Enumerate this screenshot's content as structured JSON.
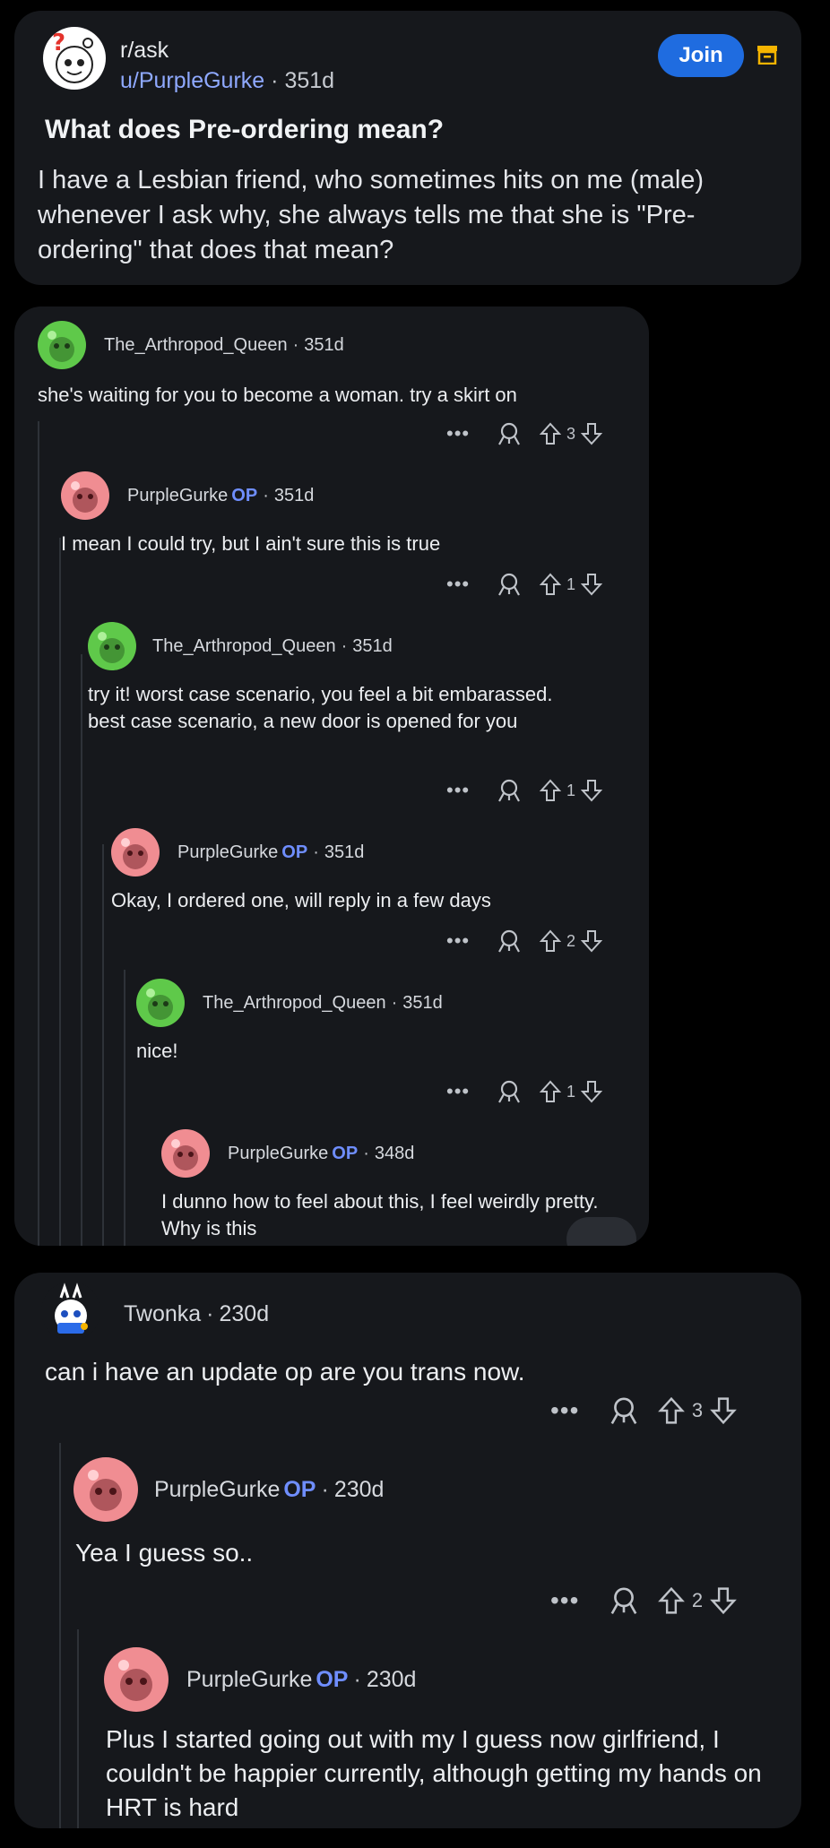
{
  "post": {
    "subreddit": "r/ask",
    "author": "u/PurpleGurke",
    "separator": "·",
    "age": "351d",
    "join_label": "Join",
    "title": "What does Pre-ordering mean?",
    "body": "I have a Lesbian friend, who sometimes hits on me (male) whenever I ask why, she always tells me that she is \"Pre-ordering\" that does that mean?"
  },
  "thread1": {
    "comments": [
      {
        "author": "The_Arthropod_Queen",
        "op": "",
        "age": "351d",
        "text": "she's waiting for you to become a woman.  try a skirt on",
        "votes": "3"
      },
      {
        "author": "PurpleGurke",
        "op": "OP",
        "age": "351d",
        "text": "I mean I could try, but I ain't sure this is true",
        "votes": "1"
      },
      {
        "author": "The_Arthropod_Queen",
        "op": "",
        "age": "351d",
        "text": "try it! worst case scenario, you feel a bit embarassed.  best case scenario, a new door is opened for you",
        "votes": "1"
      },
      {
        "author": "PurpleGurke",
        "op": "OP",
        "age": "351d",
        "text": "Okay, I ordered one, will reply in a few days",
        "votes": "2"
      },
      {
        "author": "The_Arthropod_Queen",
        "op": "",
        "age": "351d",
        "text": "nice!",
        "votes": "1"
      },
      {
        "author": "PurpleGurke",
        "op": "OP",
        "age": "348d",
        "text": "I dunno how to feel about this, I feel weirdly pretty. Why is this",
        "votes": ""
      }
    ]
  },
  "thread2": {
    "comments": [
      {
        "author": "Twonka",
        "op": "",
        "age": "230d",
        "text": "can i have an update op are you trans now.",
        "votes": "3"
      },
      {
        "author": "PurpleGurke",
        "op": "OP",
        "age": "230d",
        "text": "Yea I guess so..",
        "votes": "2"
      },
      {
        "author": "PurpleGurke",
        "op": "OP",
        "age": "230d",
        "text": "Plus I started going out with my I guess now girlfriend, I couldn't be happier currently, although getting my hands on HRT is hard",
        "votes": ""
      }
    ]
  },
  "actions": {
    "more": "•••"
  },
  "colors": {
    "background": "#000000",
    "card": "#16181c",
    "join": "#1f6ce0",
    "op": "#6f8eff",
    "green_avatar": "#5fc94a",
    "pink_avatar": "#f08d92"
  },
  "icons": [
    "snoo-avatar-icon",
    "save-icon",
    "award-icon",
    "upvote-icon",
    "downvote-icon",
    "more-icon"
  ]
}
